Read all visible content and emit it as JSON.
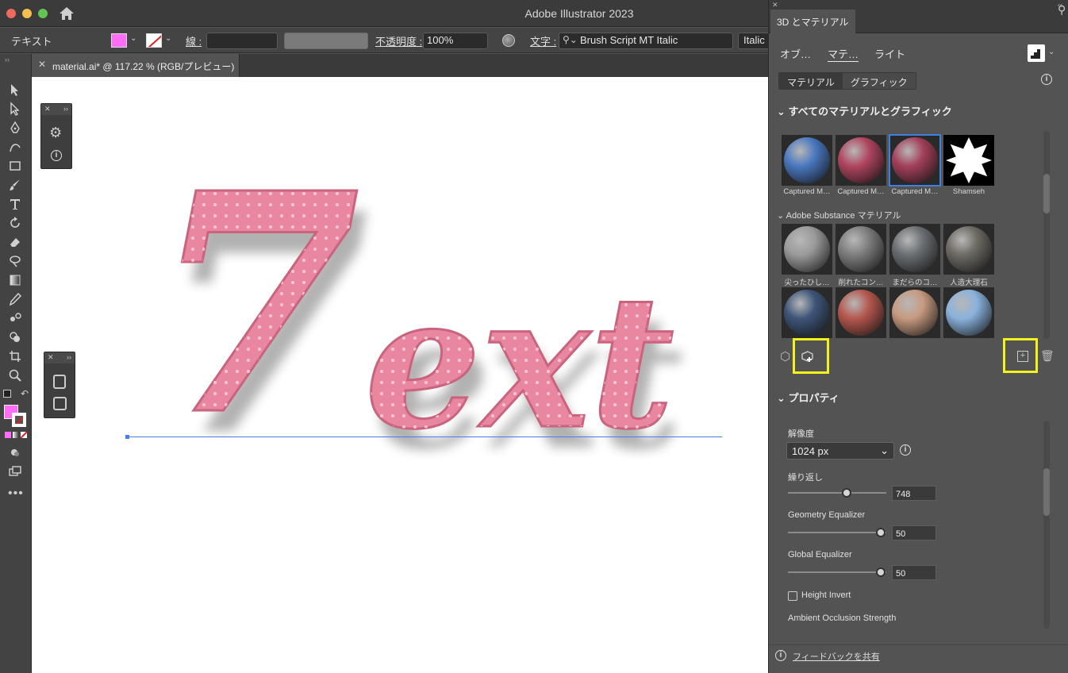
{
  "app": {
    "title": "Adobe Illustrator 2023"
  },
  "control_bar": {
    "selection_label": "テキスト",
    "stroke_label": "線 :",
    "opacity_label": "不透明度 :",
    "opacity_value": "100%",
    "char_label": "文字 :",
    "font_name": "Brush Script MT Italic",
    "font_style": "Italic",
    "fill_color": "#ff6cf5"
  },
  "document": {
    "tab_label": "material.ai* @ 117.22 % (RGB/プレビュー)"
  },
  "canvas": {
    "text": "7ext",
    "text_color": "#e8879f"
  },
  "panel": {
    "title": "3D とマテリアル",
    "tabs": [
      "オブ…",
      "マテ…",
      "ライト"
    ],
    "segments": [
      "マテリアル",
      "グラフィック"
    ],
    "all_materials_header": "すべてのマテリアルとグラフィック",
    "captured": [
      {
        "label": "Captured M…",
        "color": "#4a78c0"
      },
      {
        "label": "Captured M…",
        "color": "#b0455e"
      },
      {
        "label": "Captured M…",
        "color": "#a3405a"
      },
      {
        "label": "Shamseh",
        "color": "#ffffff"
      }
    ],
    "substance_header": "Adobe Substance マテリアル",
    "substance": [
      {
        "label": "尖ったひし…",
        "color": "#9a9a9a"
      },
      {
        "label": "削れたコン…",
        "color": "#7d7d7d"
      },
      {
        "label": "まだらのコ…",
        "color": "#6a6e72"
      },
      {
        "label": "人造大理石",
        "color": "#6d6a63"
      },
      {
        "label": "",
        "color": "#3e5578"
      },
      {
        "label": "",
        "color": "#b5574e"
      },
      {
        "label": "",
        "color": "#c79a80"
      },
      {
        "label": "",
        "color": "#8ab2dc"
      }
    ],
    "properties_header": "プロパティ",
    "resolution_label": "解像度",
    "resolution_value": "1024 px",
    "repeat_label": "繰り返し",
    "repeat_value": "748",
    "repeat_level": 0.6,
    "geo_label": "Geometry Equalizer",
    "geo_value": "50",
    "geo_level": 0.94,
    "global_label": "Global Equalizer",
    "global_value": "50",
    "global_level": 0.94,
    "height_invert_label": "Height Invert",
    "ao_label": "Ambient Occlusion Strength",
    "feedback_label": "フィードバックを共有",
    "highlight_color": "#f2f21c"
  }
}
